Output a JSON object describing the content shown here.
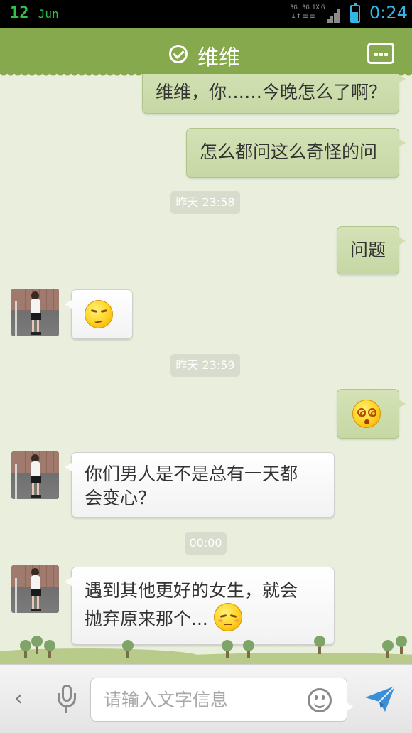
{
  "status_bar": {
    "date_day": "12",
    "date_month": "Jun",
    "network_labels": [
      "3G",
      "3G",
      "1X",
      "G"
    ],
    "battery_level": 0.55,
    "time": "0:24",
    "accent_color": "#33b5e5"
  },
  "header": {
    "title": "维维",
    "verified_icon": "check-circle-icon",
    "more_icon": "more-dots-icon",
    "background_color": "#86a94e"
  },
  "messages": [
    {
      "type": "sent",
      "text": "维维，你……今晚怎么了啊？"
    },
    {
      "type": "sent",
      "text": "怎么都问这么奇怪的问"
    },
    {
      "type": "timestamp",
      "text": "昨天 23:58"
    },
    {
      "type": "sent",
      "text": "问题"
    },
    {
      "type": "received",
      "emoji": "smirk-emoji"
    },
    {
      "type": "timestamp",
      "text": "昨天 23:59"
    },
    {
      "type": "sent",
      "emoji": "dizzy-emoji"
    },
    {
      "type": "received",
      "line1": "你们男人是不是总有一天都",
      "line2": "会变心？"
    },
    {
      "type": "timestamp",
      "text": "00:00"
    },
    {
      "type": "received",
      "line1": "遇到其他更好的女生，就会",
      "line2": "抛弃原来那个...",
      "emoji": "sad-emoji"
    }
  ],
  "input_bar": {
    "back_glyph": "‹",
    "placeholder": "请输入文字信息",
    "value": "",
    "icons": [
      "back-icon",
      "microphone-icon",
      "smiley-icon",
      "send-icon"
    ]
  },
  "colors": {
    "chat_background": "#e9efdc",
    "sent_bubble": "#cbdcab",
    "received_bubble": "#ffffff",
    "send_icon": "#3a8fd8"
  }
}
